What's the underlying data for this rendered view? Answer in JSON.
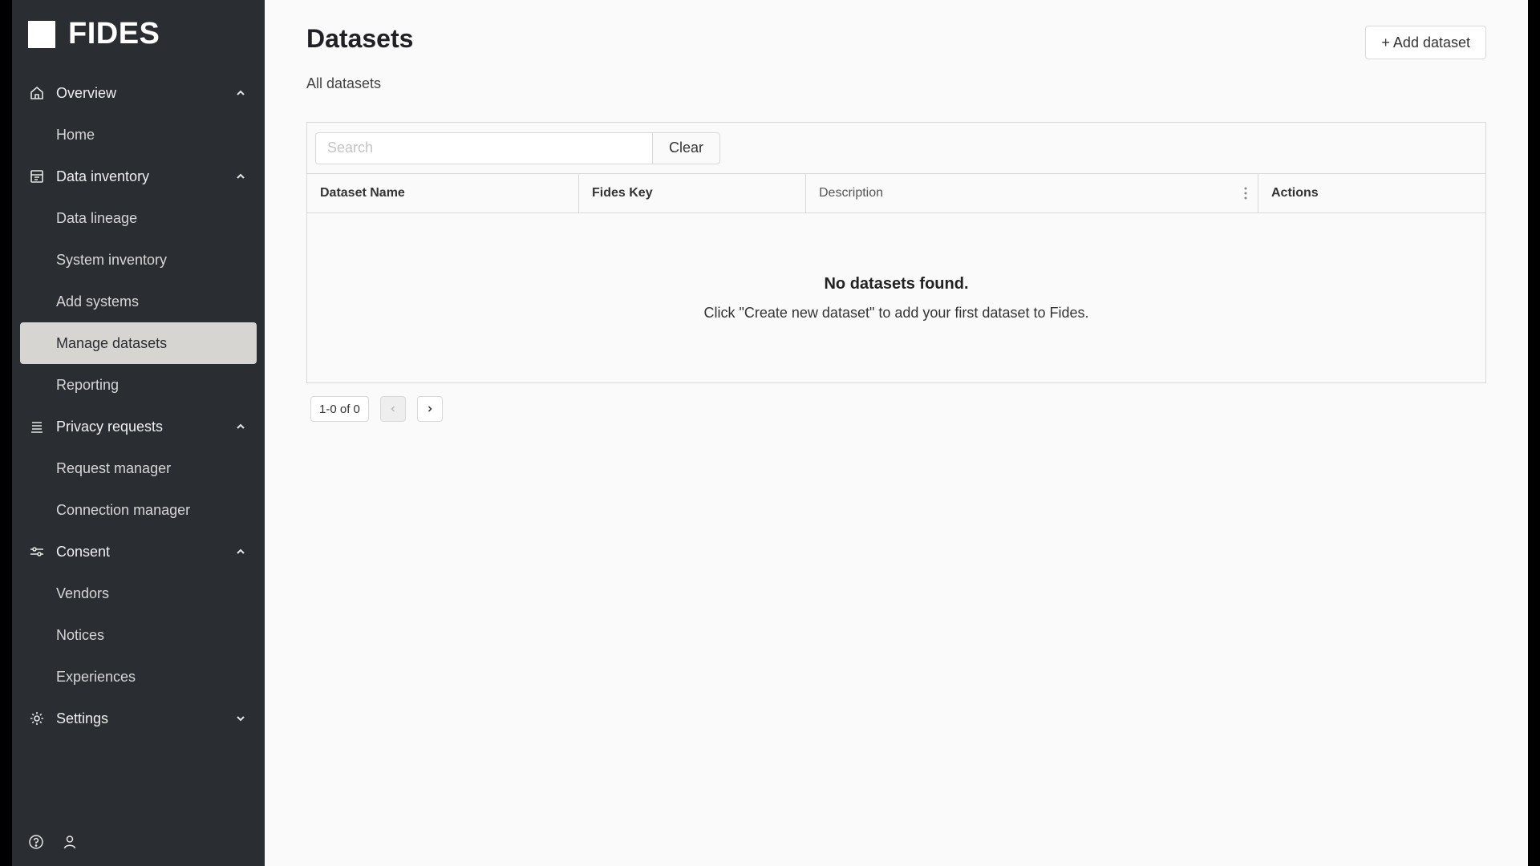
{
  "brand": {
    "name": "FIDES"
  },
  "sidebar": {
    "groups": [
      {
        "label": "Overview",
        "icon": "home-icon",
        "expanded": true,
        "items": [
          "Home"
        ]
      },
      {
        "label": "Data inventory",
        "icon": "inventory-icon",
        "expanded": true,
        "items": [
          "Data lineage",
          "System inventory",
          "Add systems",
          "Manage datasets",
          "Reporting"
        ]
      },
      {
        "label": "Privacy requests",
        "icon": "list-icon",
        "expanded": true,
        "items": [
          "Request manager",
          "Connection manager"
        ]
      },
      {
        "label": "Consent",
        "icon": "sliders-icon",
        "expanded": true,
        "items": [
          "Vendors",
          "Notices",
          "Experiences"
        ]
      },
      {
        "label": "Settings",
        "icon": "gear-icon",
        "expanded": false,
        "items": []
      }
    ],
    "active_item": "Manage datasets"
  },
  "header": {
    "title": "Datasets",
    "subtitle": "All datasets",
    "add_button": "+ Add dataset"
  },
  "table": {
    "search_placeholder": "Search",
    "search_value": "",
    "clear_label": "Clear",
    "columns": [
      "Dataset Name",
      "Fides Key",
      "Description",
      "Actions"
    ],
    "empty_title": "No datasets found.",
    "empty_text": "Click \"Create new dataset\" to add your first dataset to Fides."
  },
  "pagination": {
    "range": "1-0 of 0"
  },
  "colors": {
    "sidebar_bg": "#2a2d31",
    "active_item_bg": "#d7d5d1",
    "main_bg": "#fafafa",
    "border": "#d9d9d9"
  }
}
